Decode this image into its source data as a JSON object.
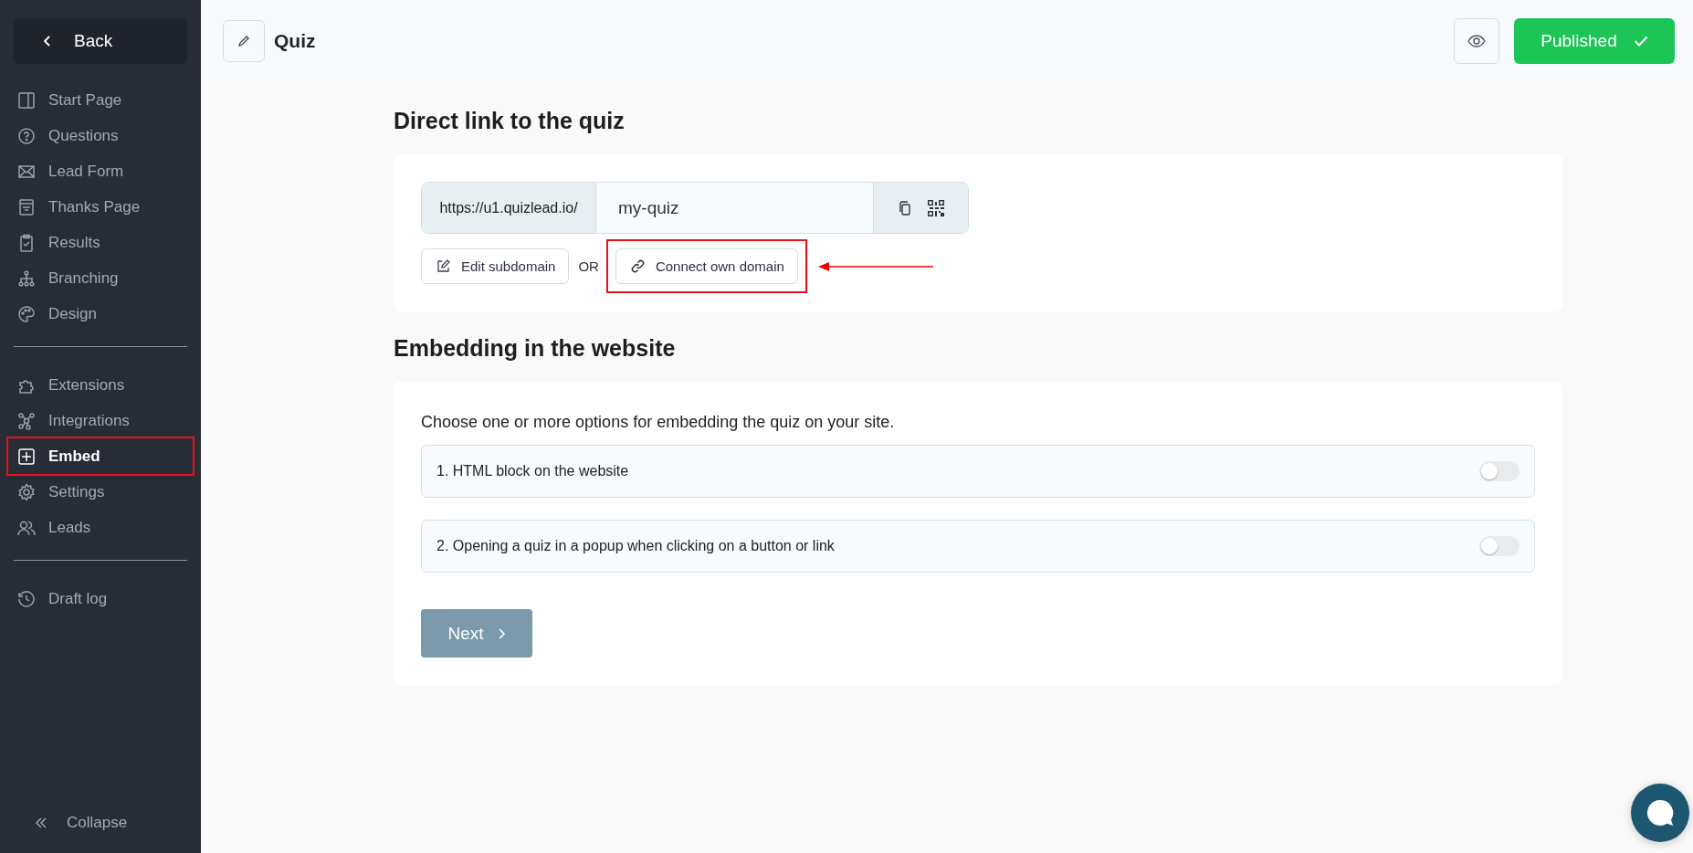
{
  "sidebar": {
    "back": "Back",
    "groups": [
      [
        {
          "label": "Start Page",
          "selected": false,
          "highlighted": false
        },
        {
          "label": "Questions",
          "selected": false,
          "highlighted": false
        },
        {
          "label": "Lead Form",
          "selected": false,
          "highlighted": false
        },
        {
          "label": "Thanks Page",
          "selected": false,
          "highlighted": false
        },
        {
          "label": "Results",
          "selected": false,
          "highlighted": false
        },
        {
          "label": "Branching",
          "selected": false,
          "highlighted": false
        },
        {
          "label": "Design",
          "selected": false,
          "highlighted": false
        }
      ],
      [
        {
          "label": "Extensions",
          "selected": false,
          "highlighted": false
        },
        {
          "label": "Integrations",
          "selected": false,
          "highlighted": false
        },
        {
          "label": "Embed",
          "selected": true,
          "highlighted": true
        },
        {
          "label": "Settings",
          "selected": false,
          "highlighted": false
        },
        {
          "label": "Leads",
          "selected": false,
          "highlighted": false
        }
      ],
      [
        {
          "label": "Draft log",
          "selected": false,
          "highlighted": false
        }
      ]
    ],
    "collapse": "Collapse"
  },
  "header": {
    "title": "Quiz",
    "publish_button": "Published"
  },
  "direct_link": {
    "heading": "Direct link to the quiz",
    "prefix": "https://u1.quizlead.io/",
    "slug": "my-quiz",
    "edit_button": "Edit subdomain",
    "separator": "OR",
    "connect_button": "Connect own domain",
    "connect_annotated": true
  },
  "embedding": {
    "heading": "Embedding in the website",
    "intro": "Choose one or more options for embedding the quiz on your site.",
    "options": [
      {
        "label": "1. HTML block on the website",
        "on": false
      },
      {
        "label": "2. Opening a quiz in a popup when clicking on a button or link",
        "on": false
      }
    ],
    "next_button": "Next"
  }
}
